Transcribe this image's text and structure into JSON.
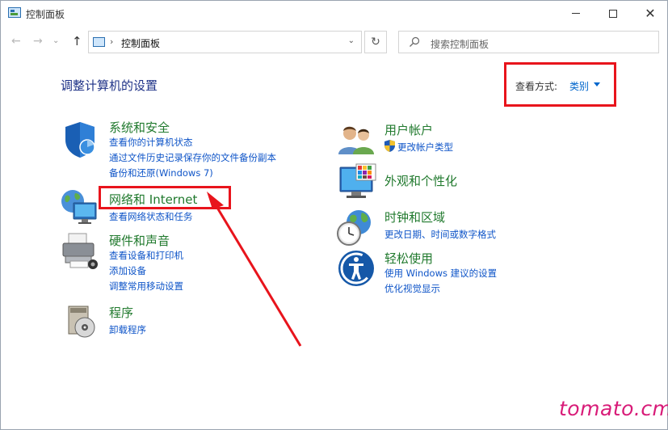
{
  "window": {
    "title": "控制面板",
    "minimize_icon": "minimize-icon",
    "maximize_icon": "maximize-icon",
    "close_icon": "close-icon"
  },
  "nav": {
    "address_path": "控制面板",
    "search_placeholder": "搜索控制面板"
  },
  "main": {
    "heading": "调整计算机的设置",
    "view_by_label": "查看方式:",
    "view_by_value": "类别"
  },
  "categories_left": [
    {
      "title": "系统和安全",
      "icon": "shield-icon",
      "links": [
        "查看你的计算机状态",
        "通过文件历史记录保存你的文件备份副本",
        "备份和还原(Windows 7)"
      ]
    },
    {
      "title": "网络和 Internet",
      "icon": "network-globe-icon",
      "links": [
        "查看网络状态和任务"
      ]
    },
    {
      "title": "硬件和声音",
      "icon": "printer-icon",
      "links": [
        "查看设备和打印机",
        "添加设备",
        "调整常用移动设置"
      ]
    },
    {
      "title": "程序",
      "icon": "programs-disc-icon",
      "links": [
        "卸载程序"
      ]
    }
  ],
  "categories_right": [
    {
      "title": "用户帐户",
      "icon": "users-icon",
      "links": [
        "更改帐户类型"
      ]
    },
    {
      "title": "外观和个性化",
      "icon": "monitor-palette-icon",
      "links": []
    },
    {
      "title": "时钟和区域",
      "icon": "clock-globe-icon",
      "links": [
        "更改日期、时间或数字格式"
      ]
    },
    {
      "title": "轻松使用",
      "icon": "ease-of-access-icon",
      "links": [
        "使用 Windows 建议的设置",
        "优化视觉显示"
      ]
    }
  ],
  "watermark": "tomato.cm",
  "colors": {
    "title_green": "#217a2e",
    "link_blue": "#0f55c8",
    "heading_blue": "#1e3287",
    "highlight_red": "#e8141c",
    "watermark_pink": "#d81b78"
  }
}
